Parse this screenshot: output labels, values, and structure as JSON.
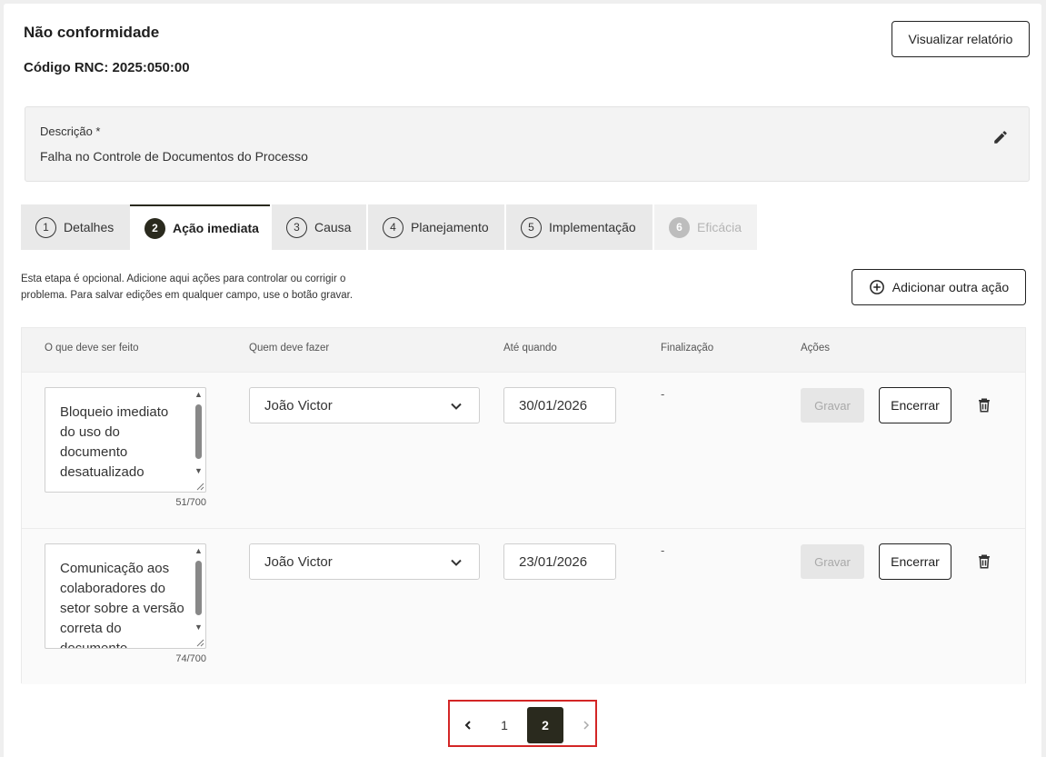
{
  "header": {
    "title": "Não conformidade",
    "code": "Código RNC: 2025:050:00",
    "report_button": "Visualizar relatório"
  },
  "description": {
    "label": "Descrição *",
    "value": "Falha no Controle de Documentos do Processo",
    "edit_icon": "pencil-icon"
  },
  "tabs": [
    {
      "num": "1",
      "label": "Detalhes",
      "state": "normal"
    },
    {
      "num": "2",
      "label": "Ação imediata",
      "state": "active"
    },
    {
      "num": "3",
      "label": "Causa",
      "state": "normal"
    },
    {
      "num": "4",
      "label": "Planejamento",
      "state": "normal"
    },
    {
      "num": "5",
      "label": "Implementação",
      "state": "normal"
    },
    {
      "num": "6",
      "label": "Eficácia",
      "state": "disabled"
    }
  ],
  "info_text": "Esta etapa é opcional. Adicione aqui ações para controlar ou corrigir o problema. Para salvar edições em qualquer campo, use o botão gravar.",
  "add_button": "Adicionar outra ação",
  "table": {
    "headers": [
      "O que deve ser feito",
      "Quem deve fazer",
      "Até quando",
      "Finalização",
      "Ações"
    ],
    "rows": [
      {
        "what": "Bloqueio imediato do uso do documento desatualizado",
        "counter": "51/700",
        "who": "João Victor",
        "date": "30/01/2026",
        "finalization": "-",
        "save": "Gravar",
        "close": "Encerrar"
      },
      {
        "what": "Comunicação aos colaboradores do setor sobre a versão correta do documento",
        "counter": "74/700",
        "who": "João Victor",
        "date": "23/01/2026",
        "finalization": "-",
        "save": "Gravar",
        "close": "Encerrar"
      }
    ]
  },
  "pagination": {
    "pages": [
      "1",
      "2"
    ],
    "current": "2"
  },
  "colors": {
    "accent_dark": "#2a2a1e",
    "highlight_border": "#d32626"
  }
}
